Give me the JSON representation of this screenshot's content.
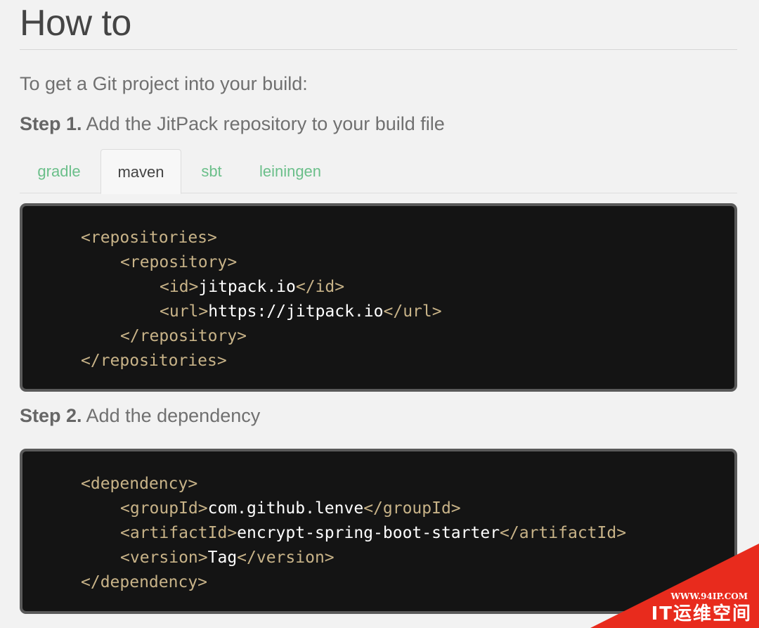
{
  "page": {
    "title": "How to",
    "intro": "To get a Git project into your build:"
  },
  "step1": {
    "label": "Step 1.",
    "text": " Add the JitPack repository to your build file"
  },
  "tabs": [
    {
      "label": "gradle",
      "active": false
    },
    {
      "label": "maven",
      "active": true
    },
    {
      "label": "sbt",
      "active": false
    },
    {
      "label": "leiningen",
      "active": false
    }
  ],
  "code1": {
    "l1": {
      "open": "<repositories>"
    },
    "l2": {
      "open": "<repository>"
    },
    "l3": {
      "open": "<id>",
      "value": "jitpack.io",
      "close": "</id>"
    },
    "l4": {
      "open": "<url>",
      "value": "https://jitpack.io",
      "close": "</url>"
    },
    "l5": {
      "close": "</repository>"
    },
    "l6": {
      "close": "</repositories>"
    }
  },
  "step2": {
    "label": "Step 2.",
    "text": " Add the dependency"
  },
  "code2": {
    "l1": {
      "open": "<dependency>"
    },
    "l2": {
      "open": "<groupId>",
      "value": "com.github.lenve",
      "close": "</groupId>"
    },
    "l3": {
      "open": "<artifactId>",
      "value": "encrypt-spring-boot-starter",
      "close": "</artifactId>"
    },
    "l4": {
      "open": "<version>",
      "value": "Tag",
      "close": "</version>"
    },
    "l5": {
      "close": "</dependency>"
    }
  },
  "watermark": {
    "url": "WWW.94IP.COM",
    "brand": "IT运维空间"
  },
  "colors": {
    "tab_link": "#6bbf8a",
    "code_bg": "#141414",
    "code_tag": "#c8b388",
    "code_value": "#ffffff",
    "watermark": "#e82b1d"
  }
}
